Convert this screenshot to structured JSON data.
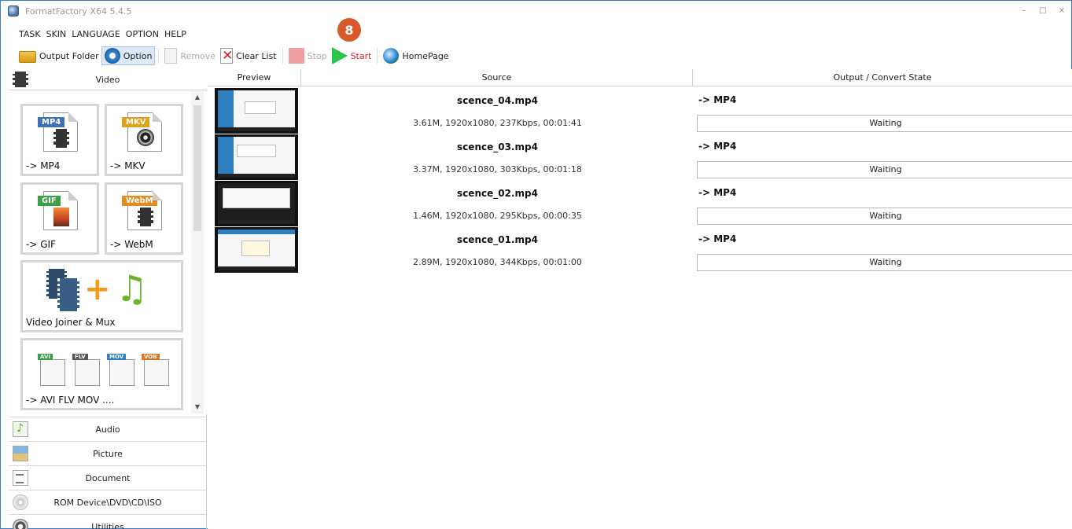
{
  "window": {
    "title": "FormatFactory X64 5.4.5",
    "minimize": "–",
    "maximize": "□",
    "close": "×"
  },
  "menu": [
    "TASK",
    "SKIN",
    "LANGUAGE",
    "OPTION",
    "HELP"
  ],
  "toolbar": {
    "output_folder": "Output Folder",
    "option": "Option",
    "remove": "Remove",
    "clear_list": "Clear List",
    "stop": "Stop",
    "start": "Start",
    "homepage": "HomePage"
  },
  "step_badge": "8",
  "categories": {
    "video": "Video",
    "audio": "Audio",
    "picture": "Picture",
    "document": "Document",
    "rom": "ROM Device\\DVD\\CD\\ISO",
    "utilities": "Utilities"
  },
  "video_tiles": {
    "mp4": {
      "tag": "MP4",
      "label": "-> MP4",
      "color": "#3f6fb6"
    },
    "mkv": {
      "tag": "MKV",
      "label": "-> MKV",
      "color": "#e0a21c"
    },
    "gif": {
      "tag": "GIF",
      "label": "-> GIF",
      "color": "#3ba045"
    },
    "webm": {
      "tag": "WebM",
      "label": "-> WebM",
      "color": "#e58a1c"
    },
    "joiner": {
      "label": "Video Joiner & Mux"
    },
    "multi": {
      "label": "-> AVI FLV MOV ....",
      "tags": [
        "AVI",
        "FLV",
        "MOV",
        "VOB"
      ],
      "colors": [
        "#3aa048",
        "#555555",
        "#2f7fc9",
        "#e2742a"
      ]
    }
  },
  "table": {
    "headers": {
      "preview": "Preview",
      "source": "Source",
      "output": "Output / Convert State"
    },
    "rows": [
      {
        "name": "scence_04.mp4",
        "info": "3.61M, 1920x1080, 237Kbps, 00:01:41",
        "output": "-> MP4",
        "state": "Waiting"
      },
      {
        "name": "scence_03.mp4",
        "info": "3.37M, 1920x1080, 303Kbps, 00:01:18",
        "output": "-> MP4",
        "state": "Waiting"
      },
      {
        "name": "scence_02.mp4",
        "info": "1.46M, 1920x1080, 295Kbps, 00:00:35",
        "output": "-> MP4",
        "state": "Waiting"
      },
      {
        "name": "scence_01.mp4",
        "info": "2.89M, 1920x1080, 344Kbps, 00:01:00",
        "output": "-> MP4",
        "state": "Waiting"
      }
    ]
  }
}
